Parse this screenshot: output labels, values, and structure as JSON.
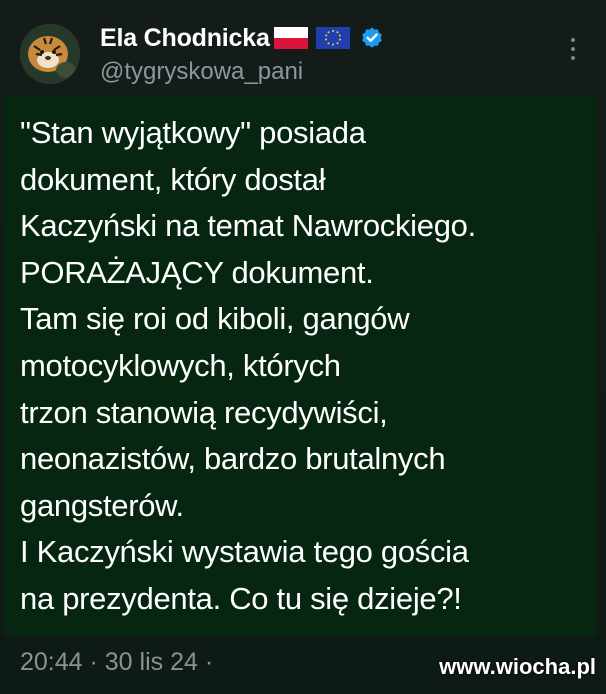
{
  "header": {
    "display_name": "Ela Chodnicka",
    "handle": "@tygryskowa_pani"
  },
  "icons": {
    "avatar": "tiger-avatar",
    "flag_pl": "poland-flag-icon",
    "flag_eu": "eu-flag-icon",
    "verified": "verified-badge-icon",
    "more": "more-options-icon"
  },
  "tweet": {
    "text": "\"Stan wyjątkowy\" posiada\ndokument, który dostał\nKaczyński na temat Nawrockiego.\nPORAŻAJĄCY dokument.\nTam się roi od kiboli, gangów\nmotocyklowych, których\ntrzon stanowią recydywiści,\nneonazistów, bardzo brutalnych\ngangsterów.\nI Kaczyński wystawia tego gościa\nna prezydenta. Co tu się dzieje?!"
  },
  "meta": {
    "timestamp": "20:44 · 30 lis 24 ·"
  },
  "watermark": "www.wiocha.pl",
  "colors": {
    "background": "#0f1a14",
    "tweet_highlight": "#062612",
    "verified_blue": "#1d9bf0",
    "muted_text": "#8a9097"
  }
}
